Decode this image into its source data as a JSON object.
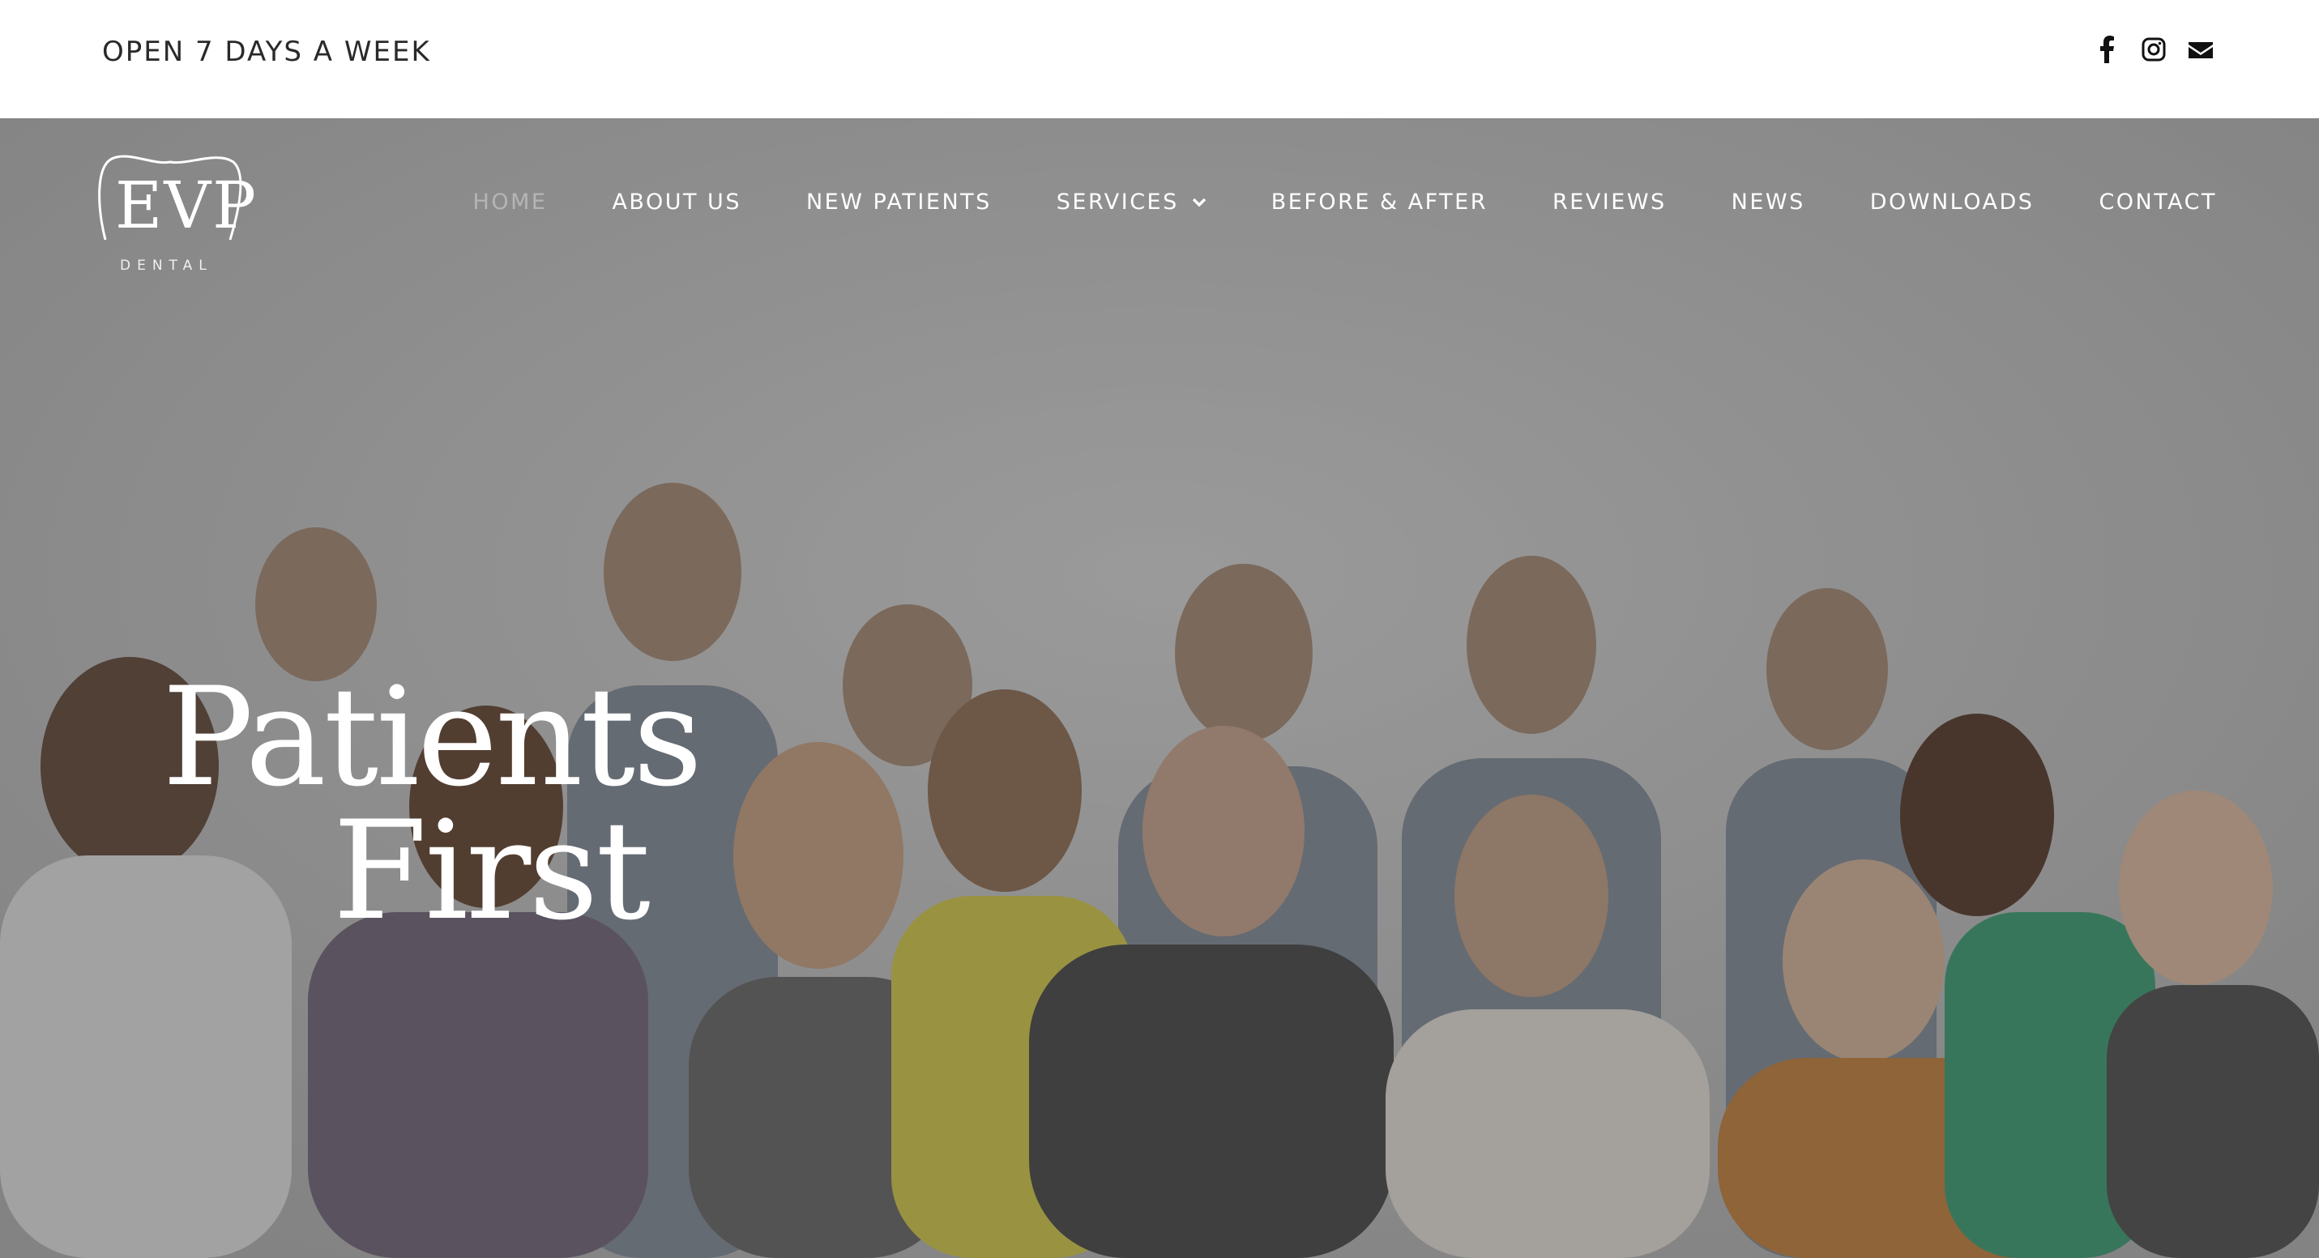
{
  "topbar": {
    "hours_text": "OPEN 7 DAYS A WEEK",
    "socials": [
      {
        "icon": "facebook-icon"
      },
      {
        "icon": "instagram-icon"
      },
      {
        "icon": "email-icon"
      }
    ]
  },
  "logo": {
    "wordmark": "EVP",
    "subtitle": "DENTAL"
  },
  "nav": {
    "items": [
      {
        "label": "HOME",
        "active": true
      },
      {
        "label": "ABOUT US"
      },
      {
        "label": "NEW PATIENTS"
      },
      {
        "label": "SERVICES",
        "has_dropdown": true
      },
      {
        "label": "BEFORE & AFTER"
      },
      {
        "label": "REVIEWS"
      },
      {
        "label": "NEWS"
      },
      {
        "label": "DOWNLOADS"
      },
      {
        "label": "CONTACT"
      }
    ]
  },
  "hero": {
    "headline_line1": "Patients",
    "headline_line2": "First"
  },
  "colors": {
    "topbar_bg": "#ffffff",
    "topbar_text": "#2a2a2a",
    "nav_text": "#ffffff",
    "nav_active": "#b5b5b5",
    "hero_overlay": "#5e5e5e"
  }
}
